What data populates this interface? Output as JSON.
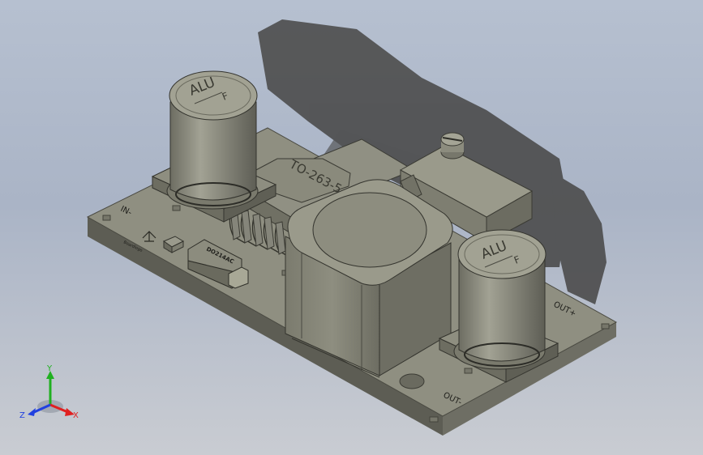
{
  "viewport": {
    "background_top": "#b6c0d0",
    "background_bottom": "#c9ccd2"
  },
  "model": {
    "pcb_color": "#8f8f81",
    "component_color": "#8a8a7c",
    "shadow_color": "#4c4c4c",
    "labels": {
      "in_minus": "IN-",
      "out_plus": "OUT+",
      "out_minus": "OUT-",
      "ic_package": "TO-263-5",
      "diode": "DO214AC",
      "cap_left_brand": "ALU",
      "cap_left_sub": "F",
      "cap_right_brand": "ALU",
      "cap_right_sub": "F",
      "silk_logo": "Boardlogo"
    }
  },
  "triad": {
    "y_label": "Y",
    "x_label": "X",
    "z_label": "Z",
    "x_color": "#e02020",
    "y_color": "#20b020",
    "z_color": "#2040e0"
  }
}
